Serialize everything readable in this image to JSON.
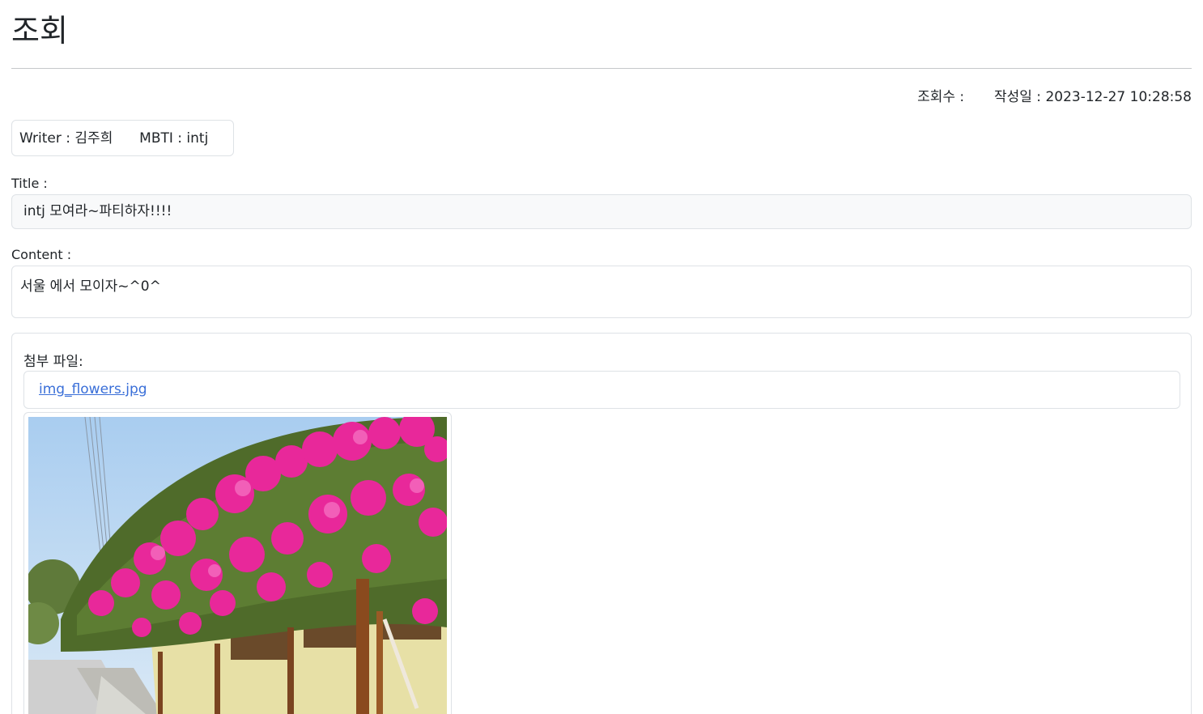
{
  "page": {
    "title": "조회"
  },
  "meta": {
    "view_count_label": "조회수 :",
    "view_count": "",
    "created_label": "작성일 :",
    "created_at": "2023-12-27 10:28:58"
  },
  "writer": {
    "writer_label": "Writer :",
    "writer_name": "김주희",
    "mbti_label": "MBTI :",
    "mbti_value": "intj"
  },
  "post": {
    "title_label": "Title :",
    "title_value": "intj 모여라~파티하자!!!!",
    "content_label": "Content :",
    "content_value": "서울 에서 모이자~^0^"
  },
  "attachments": {
    "label": "첨부 파일:",
    "files": [
      {
        "name": "img_flowers.jpg"
      }
    ]
  },
  "colors": {
    "link": "#3a6fd8",
    "border": "#dee2e6",
    "readonly_bg": "#f8f9fa",
    "flower": "#e8289a",
    "sky": "#b9d9f5"
  }
}
